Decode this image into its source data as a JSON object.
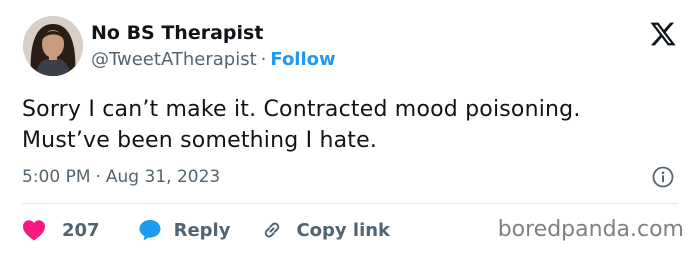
{
  "author": {
    "name": "No BS Therapist",
    "handle": "@TweetATherapist",
    "separator": "·",
    "follow_label": "Follow"
  },
  "tweet": {
    "lines": [
      "Sorry I can’t make it. Contracted mood poisoning.",
      "Must’ve been something I hate."
    ],
    "time": "5:00 PM",
    "date_separator": "·",
    "date": "Aug 31, 2023"
  },
  "actions": {
    "like_count": "207",
    "reply_label": "Reply",
    "copy_link_label": "Copy link"
  },
  "icons": {
    "platform": "x-logo-icon",
    "info": "info-icon",
    "like": "heart-icon",
    "reply": "speech-bubble-icon",
    "copy": "link-icon"
  },
  "colors": {
    "accent": "#1d9bf0",
    "like": "#f91880",
    "secondary_text": "#536471",
    "primary_text": "#0f1419"
  },
  "watermark": "boredpanda.com"
}
